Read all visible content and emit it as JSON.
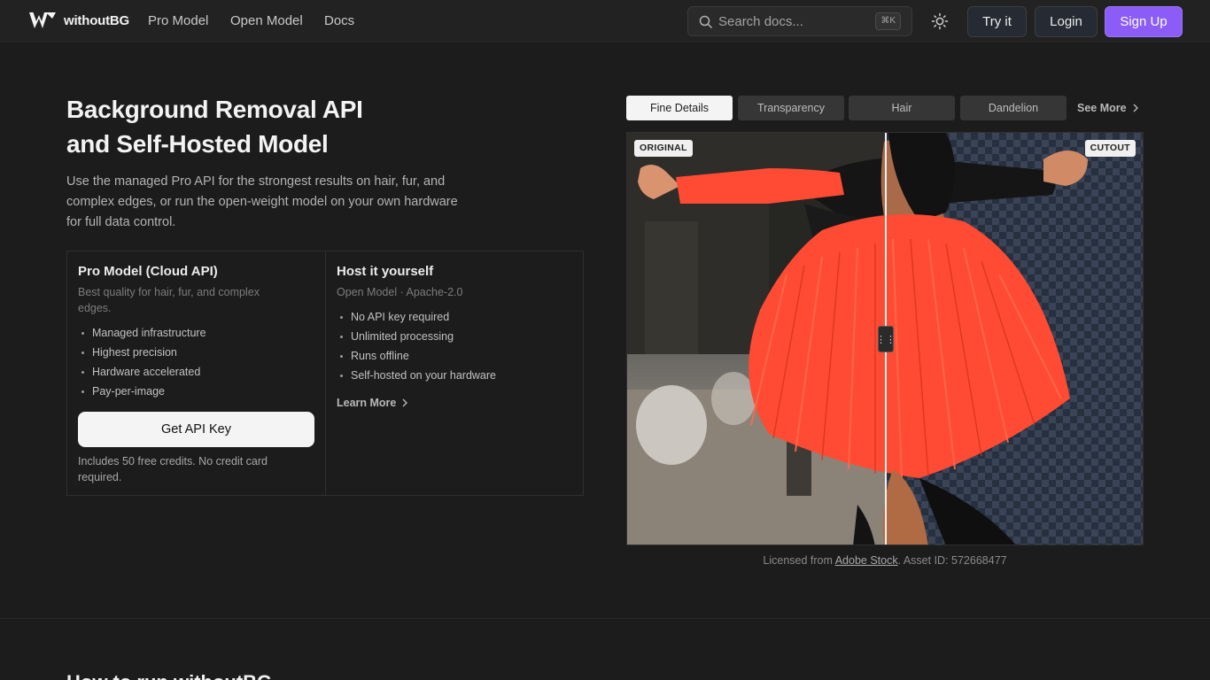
{
  "brand": {
    "name": "withoutBG"
  },
  "nav": {
    "links": [
      "Pro Model",
      "Open Model",
      "Docs"
    ],
    "search_placeholder": "Search docs...",
    "search_shortcut": "⌘K",
    "try_label": "Try it",
    "login_label": "Login",
    "signup_label": "Sign Up"
  },
  "hero": {
    "title_line1": "Background Removal API",
    "title_line2": "and Self-Hosted Model",
    "lead": "Use the managed Pro API for the strongest results on hair, fur, and complex edges, or run the open-weight model on your own hardware for full data control."
  },
  "pro_card": {
    "title": "Pro Model (Cloud API)",
    "subtitle": "Best quality for hair, fur, and complex edges.",
    "features": [
      "Managed infrastructure",
      "Highest precision",
      "Hardware accelerated",
      "Pay-per-image"
    ],
    "cta": "Get API Key",
    "note": "Includes 50 free credits. No credit card required."
  },
  "open_card": {
    "title": "Host it yourself",
    "subtitle": "Open Model · Apache-2.0",
    "features": [
      "No API key required",
      "Unlimited processing",
      "Runs offline",
      "Self-hosted on your hardware"
    ],
    "link": "Learn More"
  },
  "demo": {
    "tabs": [
      "Fine Details",
      "Transparency",
      "Hair",
      "Dandelion"
    ],
    "active_tab": "Fine Details",
    "see_more": "See More",
    "label_original": "ORIGINAL",
    "label_cutout": "CUTOUT",
    "credit_prefix": "Licensed from",
    "credit_link": "Adobe Stock",
    "credit_suffix": ". Asset ID: 572668477"
  },
  "next_section": {
    "title": "How to run withoutBG"
  },
  "colors": {
    "accent": "#8b5cf6",
    "background": "#1c1c1c",
    "nav": "#222222",
    "dress": "#ff4b33"
  }
}
